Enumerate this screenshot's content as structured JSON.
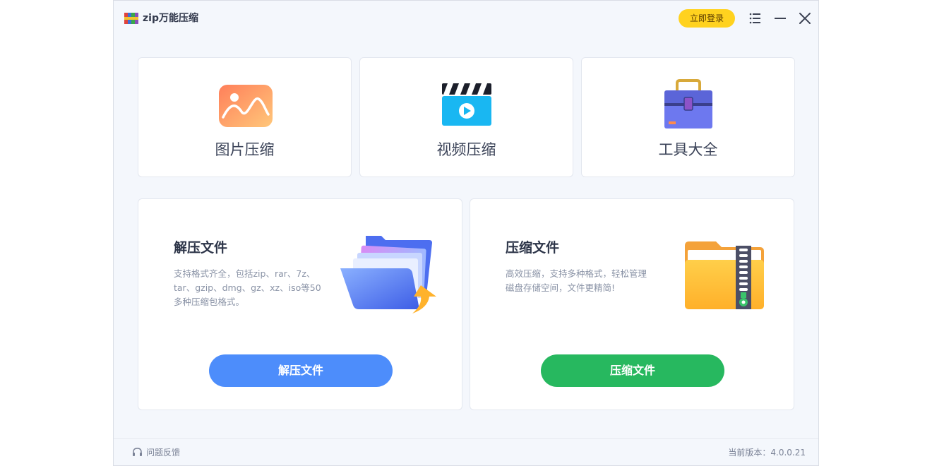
{
  "app": {
    "title": "zip万能压缩"
  },
  "header": {
    "login_label": "立即登录"
  },
  "tiles": [
    {
      "label": "图片压缩",
      "icon": "image-icon"
    },
    {
      "label": "视频压缩",
      "icon": "video-icon"
    },
    {
      "label": "工具大全",
      "icon": "toolbox-icon"
    }
  ],
  "decompress": {
    "title": "解压文件",
    "desc": "支持格式齐全，包括zip、rar、7z、tar、gzip、dmg、gz、xz、iso等50多种压缩包格式。",
    "button": "解压文件",
    "button_color": "#4d8dfb"
  },
  "compress": {
    "title": "压缩文件",
    "desc": "高效压缩，支持多种格式，轻松管理磁盘存储空间，文件更精简!",
    "button": "压缩文件",
    "button_color": "#27b85f"
  },
  "footer": {
    "feedback": "问题反馈",
    "version": "当前版本：4.0.0.21"
  }
}
